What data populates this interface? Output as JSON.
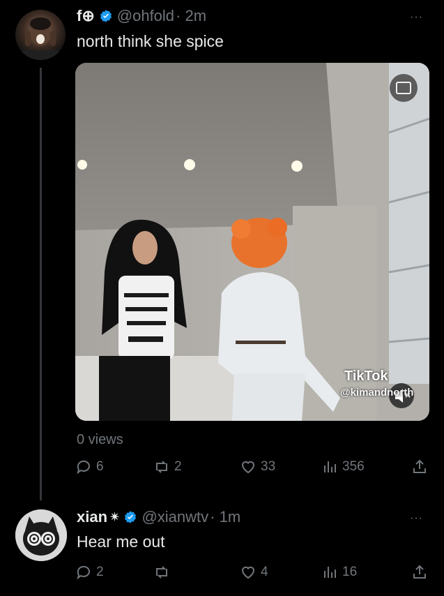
{
  "tweets": [
    {
      "display_name": "f⊕",
      "handle": "@ohfold",
      "time": "· 2m",
      "text": "north think she spice",
      "media": {
        "watermark_brand": "TikTok",
        "watermark_user": "@kimandnorth"
      },
      "views": "0 views",
      "stats": {
        "replies": "6",
        "reposts": "2",
        "likes": "33",
        "views": "356"
      }
    },
    {
      "display_name": "xian",
      "name_suffix": "✴",
      "handle": "@xianwtv",
      "time": "· 1m",
      "text": "Hear me out",
      "stats": {
        "replies": "2",
        "reposts": "",
        "likes": "4",
        "views": "16"
      }
    }
  ],
  "more_label": "···",
  "colors": {
    "background": "#000000",
    "verified": "#1d9bf0",
    "muted": "#71767b",
    "text": "#e7e9ea"
  }
}
